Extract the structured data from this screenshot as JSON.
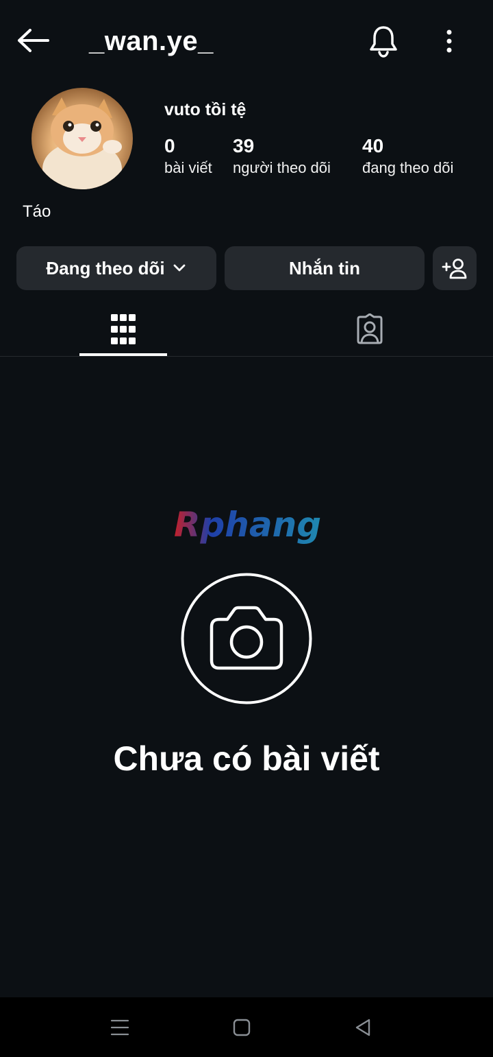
{
  "header": {
    "username": "_wan.ye_",
    "icons": {
      "back": "arrow-left-icon",
      "notifications": "bell-icon",
      "more": "more-vertical-icon"
    }
  },
  "profile": {
    "display_name": "vuto tồi tệ",
    "bio": "Táo",
    "stats": [
      {
        "value": "0",
        "label": "bài viết"
      },
      {
        "value": "39",
        "label": "người theo dõi"
      },
      {
        "value": "40",
        "label": "đang theo dõi"
      }
    ]
  },
  "actions": {
    "following_label": "Đang theo dõi",
    "message_label": "Nhắn tin",
    "add_user_icon": "add-user-icon"
  },
  "tabs": [
    {
      "icon": "grid-icon",
      "active": true
    },
    {
      "icon": "tagged-person-icon",
      "active": false
    }
  ],
  "watermark": {
    "text": "Rphang"
  },
  "empty_state": {
    "icon": "camera-icon",
    "message": "Chưa có bài viết"
  },
  "colors": {
    "background": "#0c1014",
    "button": "#25292e",
    "navbar": "#000000"
  }
}
